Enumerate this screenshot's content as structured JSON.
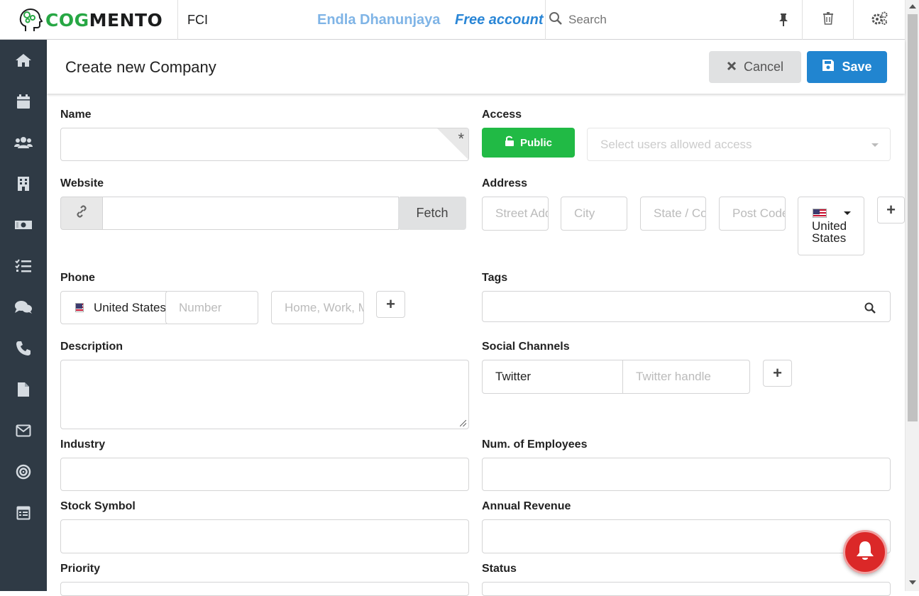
{
  "app": {
    "logo_cog": "COG",
    "logo_mento": "MENTO",
    "org_name": "FCI",
    "user_name": "Endla Dhanunjaya",
    "plan": "Free account",
    "search_placeholder": "Search"
  },
  "sidebar": {
    "items": [
      "home-icon",
      "calendar-icon",
      "contacts-icon",
      "companies-icon",
      "deals-icon",
      "tasks-icon",
      "cases-icon",
      "calls-icon",
      "documents-icon",
      "email-icon",
      "campaigns-icon",
      "forms-icon"
    ]
  },
  "header": {
    "title": "Create new Company",
    "cancel_label": "Cancel",
    "save_label": "Save"
  },
  "form": {
    "name_label": "Name",
    "name_required_mark": "*",
    "access_label": "Access",
    "public_label": "Public",
    "access_placeholder": "Select users allowed access",
    "website_label": "Website",
    "fetch_label": "Fetch",
    "address_label": "Address",
    "street_placeholder": "Street Address",
    "city_placeholder": "City",
    "state_placeholder": "State / County",
    "postcode_placeholder": "Post Code",
    "address_country": "United States",
    "phone_label": "Phone",
    "phone_country": "United States",
    "phone_number_placeholder": "Number",
    "phone_type_placeholder": "Home, Work, Mobile",
    "tags_label": "Tags",
    "description_label": "Description",
    "social_label": "Social Channels",
    "social_channel": "Twitter",
    "social_handle_placeholder": "Twitter handle",
    "industry_label": "Industry",
    "employees_label": "Num. of Employees",
    "stock_label": "Stock Symbol",
    "revenue_label": "Annual Revenue",
    "priority_label": "Priority",
    "status_label": "Status"
  },
  "colors": {
    "brand_green": "#27a744",
    "sidebar_bg": "#2f3a45",
    "save_blue": "#2185d0",
    "public_green": "#21ba45",
    "notif_red": "#db2828"
  }
}
